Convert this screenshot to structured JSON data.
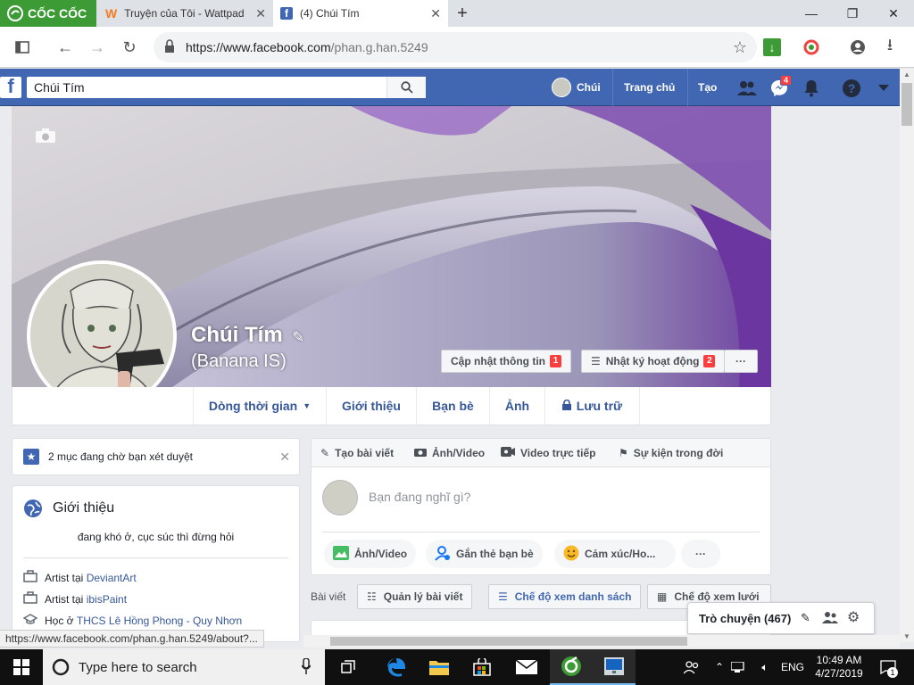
{
  "browser": {
    "brand": "CỐC CỐC",
    "tabs": [
      {
        "title": "Truyện của Tôi - Wattpad",
        "icon": "wattpad-icon"
      },
      {
        "title": "(4) Chúi Tím",
        "icon": "facebook-icon"
      }
    ],
    "url_host": "https://www.facebook.com",
    "url_path": "/phan.g.han.5249",
    "status_url": "https://www.facebook.com/phan.g.han.5249/about?..."
  },
  "fb": {
    "search_value": "Chúi Tím",
    "nav": {
      "profile": "Chúi",
      "home": "Trang chủ",
      "create": "Tạo"
    },
    "messenger_count": "4",
    "accent": "#4267b2"
  },
  "profile": {
    "name": "Chúi Tím",
    "alt_name": "(Banana IS)",
    "update_info": "Cập nhật thông tin",
    "update_info_badge": "1",
    "activity_log": "Nhật ký hoạt động",
    "activity_log_badge": "2",
    "more": "···",
    "tabs": [
      "Dòng thời gian",
      "Giới thiệu",
      "Bạn bè",
      "Ảnh",
      "Lưu trữ"
    ]
  },
  "pending": {
    "text": "2 mục đang chờ bạn xét duyệt"
  },
  "intro": {
    "title": "Giới thiệu",
    "bio": "đang khó ở, cục súc thì đừng hỏi",
    "items": [
      {
        "prefix": "Artist tại ",
        "link": "DeviantArt"
      },
      {
        "prefix": "Artist tại ",
        "link": "ibisPaint"
      },
      {
        "prefix": "Học ở ",
        "link": "THCS Lê Hồng Phong - Quy Nhơn"
      }
    ]
  },
  "composer": {
    "tabs": [
      "Tạo bài viết",
      "Ảnh/Video",
      "Video trực tiếp",
      "Sự kiện trong đời"
    ],
    "placeholder": "Bạn đang nghĩ gì?",
    "actions": [
      "Ảnh/Video",
      "Gắn thẻ bạn bè",
      "Cảm xúc/Ho...",
      "···"
    ]
  },
  "posts_bar": {
    "label": "Bài viết",
    "manage": "Quản lý bài viết",
    "list_view": "Chế độ xem danh sách",
    "grid_view": "Chế độ xem lưới"
  },
  "chat": {
    "label": "Trò chuyện (467)"
  },
  "taskbar": {
    "search_placeholder": "Type here to search",
    "lang": "ENG",
    "time": "10:49 AM",
    "date": "4/27/2019",
    "notif_count": "1"
  }
}
